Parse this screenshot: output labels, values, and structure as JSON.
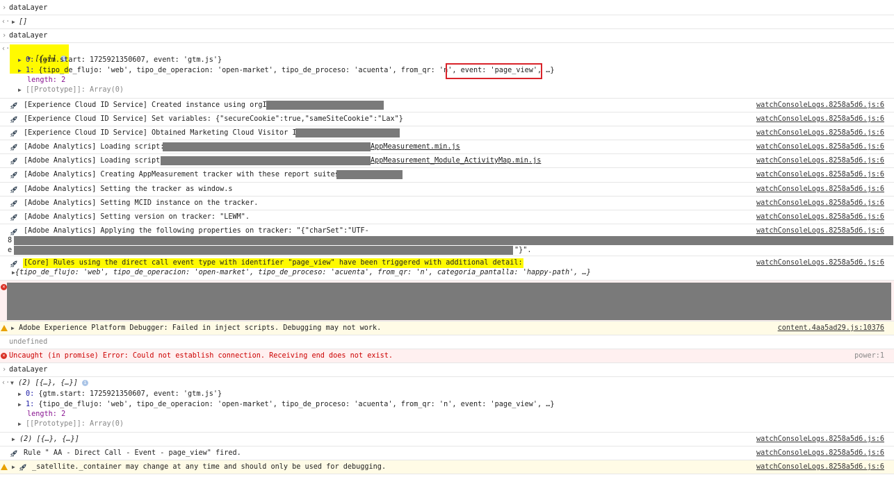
{
  "console": {
    "prompt1": "dataLayer",
    "result1": "[]",
    "prompt2": "dataLayer",
    "result2_summary": "[{…}]",
    "result2_item0_idx": "0:",
    "result2_item0": "{gtm.start: 1725921350607, event: 'gtm.js'}",
    "result2_item1_idx": "1:",
    "result2_item1_a": "{tipo_de_flujo: 'web', tipo_de_operacion: 'open-market', tipo_de_proceso: 'acuenta', from_qr: 'n', ",
    "result2_item1_b": "event: 'page_view', …}",
    "result2_length": "length: 2",
    "result2_proto": "[[Prototype]]: Array(0)",
    "logs": [
      {
        "text": "[Experience Cloud ID Service] Created instance using orgId:",
        "src": "watchConsoleLogs.8258a5d6.js:6"
      },
      {
        "text": "[Experience Cloud ID Service] Set variables: {\"secureCookie\":true,\"sameSiteCookie\":\"Lax\"}",
        "src": "watchConsoleLogs.8258a5d6.js:6"
      },
      {
        "text": "[Experience Cloud ID Service] Obtained Marketing Cloud Visitor Id:",
        "src": "watchConsoleLogs.8258a5d6.js:6"
      },
      {
        "text": "[Adobe Analytics] Loading script: ",
        "tail": "AppMeasurement.min.js",
        "src": "watchConsoleLogs.8258a5d6.js:6"
      },
      {
        "text": "[Adobe Analytics] Loading script: ",
        "tail": "AppMeasurement_Module_ActivityMap.min.js",
        "src": "watchConsoleLogs.8258a5d6.js:6"
      },
      {
        "text": "[Adobe Analytics] Creating AppMeasurement tracker with these report suites: ",
        "src": "watchConsoleLogs.8258a5d6.js:6"
      },
      {
        "text": "[Adobe Analytics] Setting the tracker as window.s",
        "src": "watchConsoleLogs.8258a5d6.js:6"
      },
      {
        "text": "[Adobe Analytics] Setting MCID instance on the tracker.",
        "src": "watchConsoleLogs.8258a5d6.js:6"
      },
      {
        "text": "[Adobe Analytics] Setting version on tracker: \"LEWM\".",
        "src": "watchConsoleLogs.8258a5d6.js:6"
      },
      {
        "text": "[Adobe Analytics] Applying the following properties on tracker: \"{\"charSet\":\"UTF-",
        "src": "watchConsoleLogs.8258a5d6.js:6"
      }
    ],
    "props_line2_start": "8",
    "props_line3_start": "e",
    "props_line3_end": "\"}\".",
    "core_text": "[Core] Rules using the direct call event type with identifier \"page_view\" have been triggered with additional detail:",
    "core_src": "watchConsoleLogs.8258a5d6.js:6",
    "core_detail": "{tipo_de_flujo: 'web', tipo_de_operacion: 'open-market', tipo_de_proceso: 'acuenta', from_qr: 'n', categoria_pantalla: 'happy-path', …}",
    "warn_text": "Adobe Experience Platform Debugger: Failed in inject scripts. Debugging may not work.",
    "warn_src": "content.4aa5ad29.js:10376",
    "undefined_text": "undefined",
    "err_text": "Uncaught (in promise) Error: Could not establish connection. Receiving end does not exist.",
    "err_src": "power:1",
    "prompt3": "dataLayer",
    "result3_summary": "(2) [{…}, {…}]",
    "result3_item0_idx": "0:",
    "result3_item0": "{gtm.start: 1725921350607, event: 'gtm.js'}",
    "result3_item1_idx": "1:",
    "result3_item1": "{tipo_de_flujo: 'web', tipo_de_operacion: 'open-market', tipo_de_proceso: 'acuenta', from_qr: 'n', event: 'page_view', …}",
    "result3_length": "length: 2",
    "result3_proto": "[[Prototype]]: Array(0)",
    "result4_summary": "(2) [{…}, {…}]",
    "result4_src": "watchConsoleLogs.8258a5d6.js:6",
    "rule_text": "Rule \" AA - Direct Call - Event - page_view\" fired.",
    "rule_src": "watchConsoleLogs.8258a5d6.js:6",
    "satellite_text": "_satellite._container may change at any time and should only be used for debugging.",
    "satellite_src": "watchConsoleLogs.8258a5d6.js:6"
  }
}
